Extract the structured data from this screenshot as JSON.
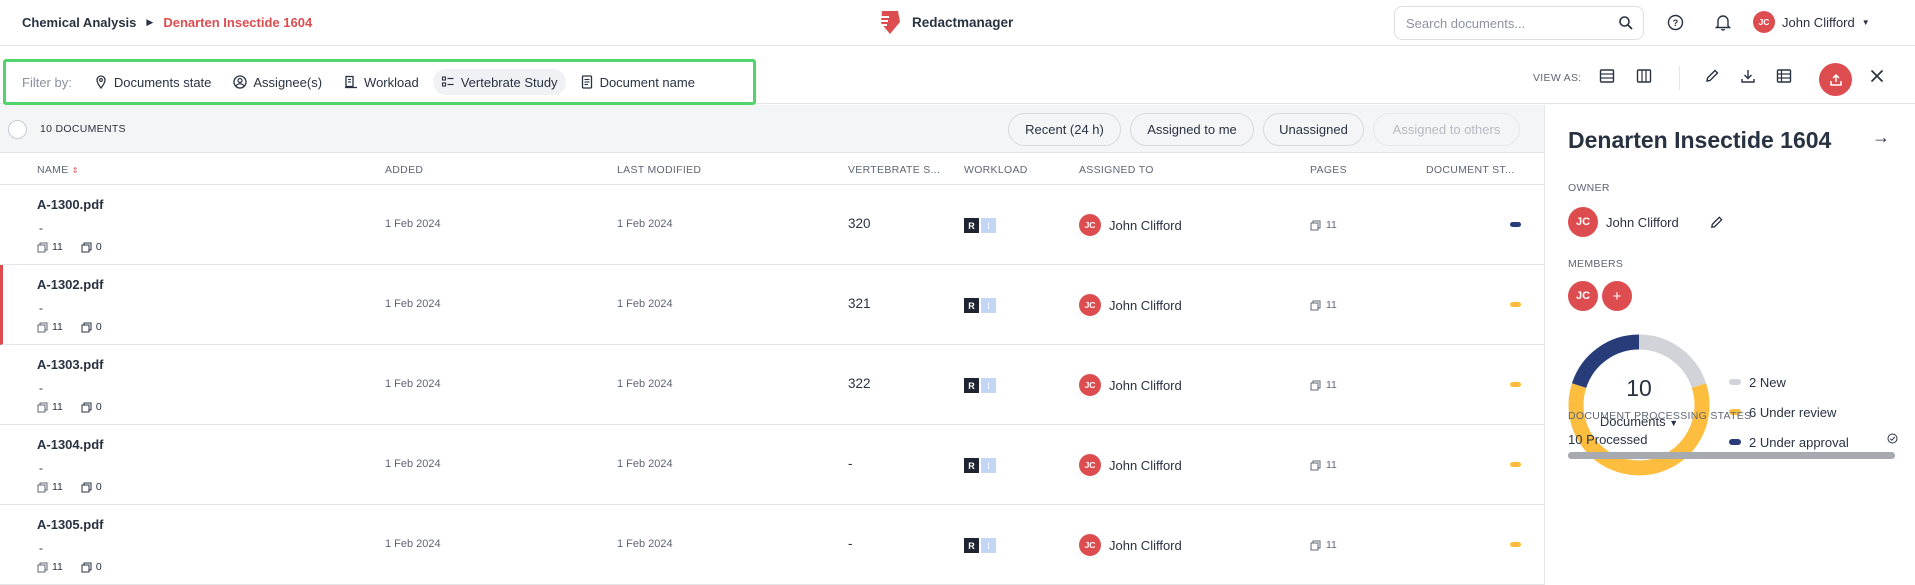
{
  "header": {
    "breadcrumb_parent": "Chemical Analysis",
    "breadcrumb_current": "Denarten Insectide 1604",
    "brand_name": "Redactmanager",
    "search_placeholder": "Search documents...",
    "user_initials": "JC",
    "user_name": "John Clifford"
  },
  "filters": {
    "label": "Filter by:",
    "items": [
      {
        "label": "Documents state",
        "icon": "pin-icon"
      },
      {
        "label": "Assignee(s)",
        "icon": "person-circle-icon"
      },
      {
        "label": "Workload",
        "icon": "workload-icon"
      },
      {
        "label": "Vertebrate Study",
        "icon": "list-icon",
        "active": true
      },
      {
        "label": "Document name",
        "icon": "document-icon"
      }
    ]
  },
  "toolbar": {
    "view_as_label": "VIEW AS:",
    "icons": [
      "list-view-icon",
      "column-view-icon",
      "edit-icon",
      "download-icon",
      "table-icon",
      "upload-icon",
      "close-icon"
    ]
  },
  "list": {
    "count_label": "10 DOCUMENTS",
    "quick_filters": [
      "Recent (24 h)",
      "Assigned to me",
      "Unassigned",
      "Assigned to others"
    ],
    "columns": [
      "NAME",
      "ADDED",
      "LAST MODIFIED",
      "VERTEBRATE S...",
      "WORKLOAD",
      "ASSIGNED TO",
      "PAGES",
      "DOCUMENT ST..."
    ],
    "rows": [
      {
        "name": "A-1300.pdf",
        "sub": "-",
        "pages_count": "11",
        "comments": "0",
        "added": "1 Feb 2024",
        "modified": "1 Feb 2024",
        "vertebrate": "320",
        "wl_r": "R",
        "wl_i": "I",
        "assignee_initials": "JC",
        "assignee": "John Clifford",
        "pages": "11",
        "state_color": "#283c7a",
        "flag": false
      },
      {
        "name": "A-1302.pdf",
        "sub": "-",
        "pages_count": "11",
        "comments": "0",
        "added": "1 Feb 2024",
        "modified": "1 Feb 2024",
        "vertebrate": "321",
        "wl_r": "R",
        "wl_i": "I",
        "assignee_initials": "JC",
        "assignee": "John Clifford",
        "pages": "11",
        "state_color": "#fdbd3e",
        "flag": true
      },
      {
        "name": "A-1303.pdf",
        "sub": "-",
        "pages_count": "11",
        "comments": "0",
        "added": "1 Feb 2024",
        "modified": "1 Feb 2024",
        "vertebrate": "322",
        "wl_r": "R",
        "wl_i": "I",
        "assignee_initials": "JC",
        "assignee": "John Clifford",
        "pages": "11",
        "state_color": "#fdbd3e",
        "flag": false
      },
      {
        "name": "A-1304.pdf",
        "sub": "-",
        "pages_count": "11",
        "comments": "0",
        "added": "1 Feb 2024",
        "modified": "1 Feb 2024",
        "vertebrate": "-",
        "wl_r": "R",
        "wl_i": "I",
        "assignee_initials": "JC",
        "assignee": "John Clifford",
        "pages": "11",
        "state_color": "#fdbd3e",
        "flag": false
      },
      {
        "name": "A-1305.pdf",
        "sub": "-",
        "pages_count": "11",
        "comments": "0",
        "added": "1 Feb 2024",
        "modified": "1 Feb 2024",
        "vertebrate": "-",
        "wl_r": "R",
        "wl_i": "I",
        "assignee_initials": "JC",
        "assignee": "John Clifford",
        "pages": "11",
        "state_color": "#fdbd3e",
        "flag": false
      }
    ]
  },
  "panel": {
    "title": "Denarten Insectide 1604",
    "owner_label": "OWNER",
    "owner_initials": "JC",
    "owner_name": "John Clifford",
    "members_label": "MEMBERS",
    "member_initials": "JC",
    "add_member": "+",
    "donut_total": "10",
    "donut_label": "Documents",
    "legend": [
      {
        "label": "2 New",
        "value": 2,
        "color": "#d1d3d8"
      },
      {
        "label": "6 Under review",
        "value": 6,
        "color": "#fdbd3e"
      },
      {
        "label": "2 Under approval",
        "value": 2,
        "color": "#283c7a"
      }
    ],
    "processing_label": "DOCUMENT PROCESSING STATES",
    "processed_text": "10 Processed",
    "processed_fraction": 1.0
  }
}
